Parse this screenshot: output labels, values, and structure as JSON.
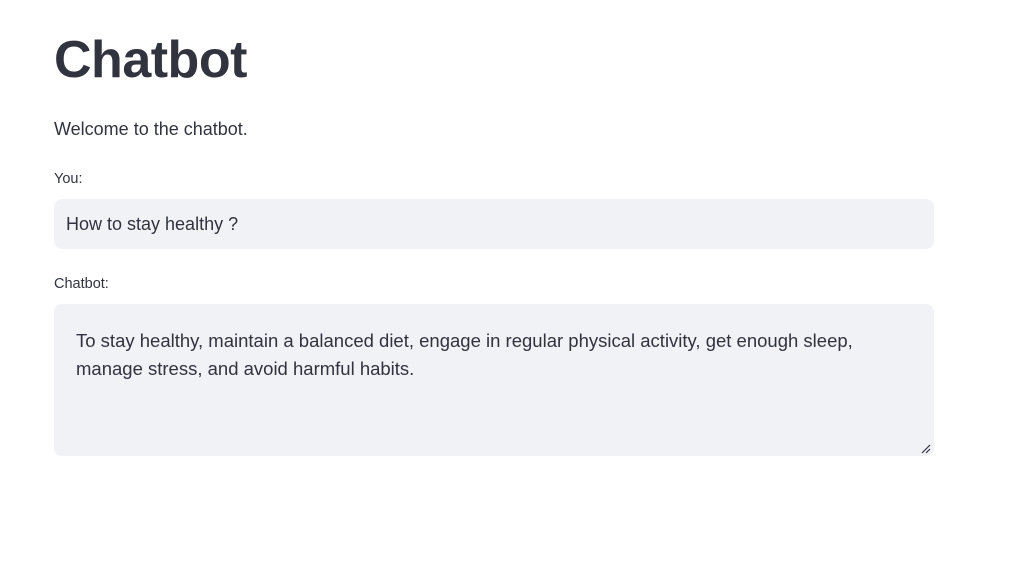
{
  "page": {
    "title": "Chatbot",
    "welcome": "Welcome to the chatbot."
  },
  "user_input": {
    "label": "You:",
    "value": "How to stay healthy ?"
  },
  "bot_output": {
    "label": "Chatbot:",
    "value": "To stay healthy, maintain a balanced diet, engage in regular physical activity, get enough sleep, manage stress, and avoid harmful habits."
  },
  "icons": {
    "resize": "resize-handle-icon"
  },
  "colors": {
    "text": "#31333f",
    "field_background": "#f0f2f6",
    "page_background": "#ffffff"
  }
}
